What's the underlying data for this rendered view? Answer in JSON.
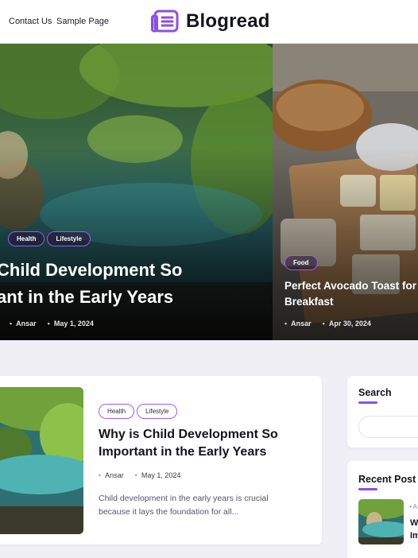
{
  "nav": {
    "contact": "Contact Us",
    "sample": "Sample Page"
  },
  "brand": {
    "name": "Blogread",
    "accent": "#8a4fe8"
  },
  "hero_left": {
    "tags": [
      "Health",
      "Lifestyle"
    ],
    "title_line1": "Child Development So",
    "title_line2": "ant in the Early Years",
    "author": "Ansar",
    "date": "May 1, 2024"
  },
  "hero_right": {
    "tag": "Food",
    "title_line1": "Perfect Avocado Toast for",
    "title_line2": "Breakfast",
    "author": "Ansar",
    "date": "Apr 30, 2024"
  },
  "post_card": {
    "tags": [
      "Health",
      "Lifestyle"
    ],
    "title": "Why is Child Development So Important in the Early Years",
    "author": "Ansar",
    "date": "May 1, 2024",
    "excerpt": "Child development in the early years is crucial because it lays the foundation for all..."
  },
  "sidebar": {
    "search_title": "Search",
    "search_placeholder": "",
    "recent_title": "Recent Post",
    "recent_partial_1": "W",
    "recent_partial_2": "Im",
    "recent_partial_meta": "A"
  }
}
